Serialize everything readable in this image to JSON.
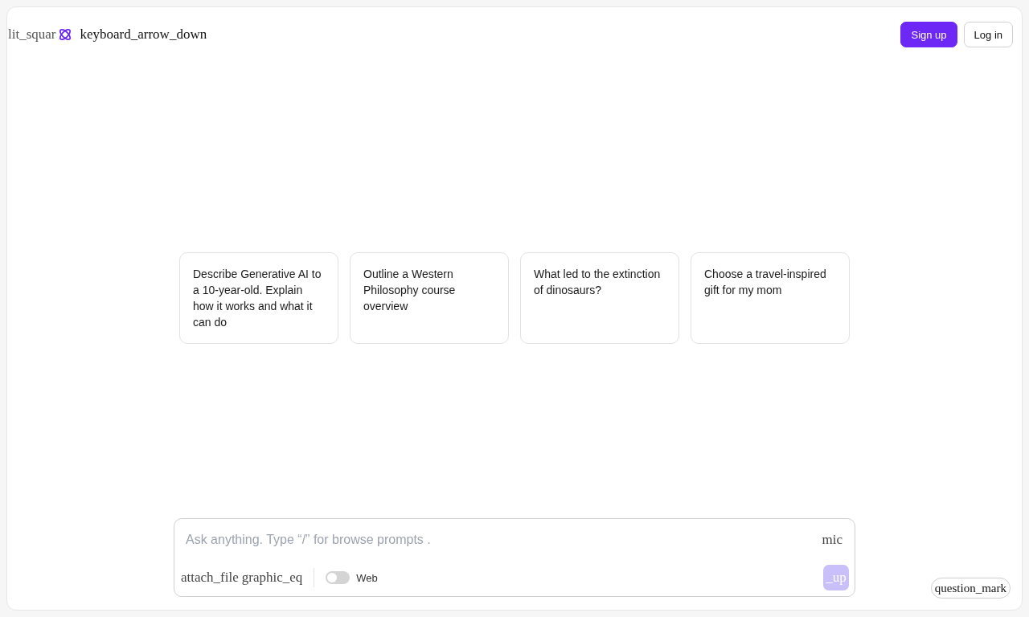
{
  "header": {
    "panel_icon_text": "lit_squar",
    "dropdown_icon_text": "keyboard_arrow_down",
    "buttons": [
      {
        "label": "Sign up",
        "kind": "primary"
      },
      {
        "label": "Log in",
        "kind": "secondary"
      }
    ]
  },
  "suggestions": [
    {
      "text": "Describe Generative AI to a 10-year-old. Explain how it works and what it can do"
    },
    {
      "text": "Outline a Western Philosophy course overview"
    },
    {
      "text": "What led to the extinction of dinosaurs?"
    },
    {
      "text": "Choose a travel-inspired gift for my mom"
    }
  ],
  "composer": {
    "placeholder": "Ask anything. Type “/” for browse prompts .",
    "mic_icon_text": "mic",
    "attach_icon_text": "attach_file",
    "voice_icon_text": "graphic_eq",
    "web": {
      "label": "Web",
      "on": false
    },
    "send_button": {
      "label": "_up",
      "disabled": true
    }
  },
  "help_button": {
    "label": "question_mark"
  }
}
